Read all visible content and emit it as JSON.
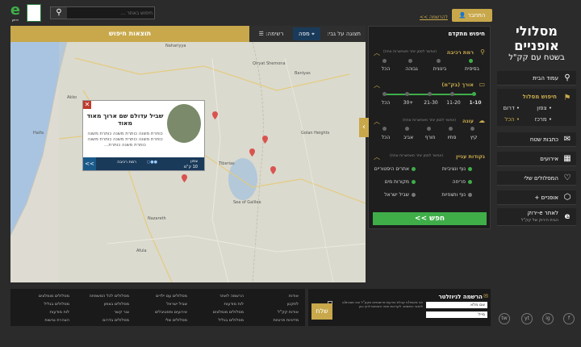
{
  "header": {
    "search_placeholder": "חיפוש באתר ...",
    "connect_label": "התחבר",
    "register_label": "להרשמה >>",
    "logo_e": "e",
    "logo_e_sub": "ירוק",
    "site_title": "מסלולי אופניים",
    "site_subtitle": "בשטח עם קק\"ל"
  },
  "menu": {
    "home": "עמוד הבית",
    "trip_search": "חיפוש מסלול",
    "north": "צפון",
    "south": "דרום",
    "center": "מרכז",
    "all": "הכל",
    "writers": "כתבות שטח",
    "events": "אירועים",
    "favorites": "המסלולים שלי",
    "bikes": "אופניים +",
    "green_title": "לאתר e-ירוק",
    "green_sub": "הבית הירוק של קק\"ל"
  },
  "filter": {
    "title": "חיפוש מתקדם",
    "difficulty": {
      "label": "רמת רכיבה",
      "sub": "(אפשר לסמן יותר מאפשרות אחת)",
      "options": [
        "בסיסית",
        "בינונית",
        "גבוהה",
        "הכל"
      ]
    },
    "length": {
      "label": "אורך (בק\"מ)",
      "options": [
        "1-10",
        "11-20",
        "21-30",
        "+30",
        "הכל"
      ]
    },
    "season": {
      "label": "עונה",
      "sub": "(אפשר לסמן יותר מאפשרות אחת)",
      "options": [
        "קיץ",
        "סתיו",
        "חורף",
        "אביב",
        "הכל"
      ]
    },
    "points": {
      "label": "נקודות עניין",
      "sub": "(אפשר לסמן יותר מאפשרות אחת)",
      "options": [
        "נוף ונציביות",
        "אתרים היסטוריים",
        "פריחה",
        "מקורות מים",
        "נוף ותצפיות",
        "שביל ישראל"
      ]
    },
    "submit": "חפש >>"
  },
  "results": {
    "title": "תוצאות חיפוש",
    "view_label": "תצוגה על גבי:",
    "tab_map": "מפה",
    "tab_list": "רשימה:"
  },
  "popup": {
    "title": "שביל עדולם שם ארוך מאוד מאוד",
    "desc": "כותרת משנה כותרת משנה כותרת משנה כותרת משנה כותרת משנה כותרת משנה כותרת משנה כותרת...",
    "region": "צפון",
    "length": "10 ק\"מ",
    "level": "רמת רכיבה",
    "more": ">>"
  },
  "map_places": [
    "Nahariyya",
    "Akko",
    "Haifa",
    "Tiberias",
    "Sea of Galilee",
    "Nazareth",
    "Afula",
    "Baniyas",
    "Golan Heights",
    "Qiryat Shemona"
  ],
  "footer": {
    "col1": [
      "אודות",
      "לתקנון",
      "אודות קק\"ל",
      "מדיניות פרטיות"
    ],
    "col2": [
      "הרשמה לאתר",
      "לוח מודעות",
      "מסלולים מומלצים",
      "מסלולים בגליל"
    ],
    "col3": [
      "מסלולים עם ילדים",
      "שביל ישראל",
      "אירועים ופסטיבלים",
      "מסלולים שלי"
    ],
    "col4": [
      "מסלולים לכל המשפחה",
      "מסלולים בצפון",
      "צור קשר",
      "מסלולים בדרום"
    ],
    "col5": [
      "מסלולים מומלצים",
      "מסלולים בגליל",
      "לוח מודעות",
      "הצהרת נגישות"
    ]
  },
  "newsletter": {
    "title": "הרשמה לניוזלטר",
    "name_placeholder": "שם מלא",
    "email_placeholder": "מייל",
    "terms": "אני מאשר/ת קבלת הודעות פרסומיות מקק\"ל ואני מסכים/ה לתנאי השימוש. לקריאת תנאי השימוש לחץ כאן",
    "send": "שלח"
  },
  "social": [
    "f",
    "ig",
    "yt",
    "tw"
  ]
}
